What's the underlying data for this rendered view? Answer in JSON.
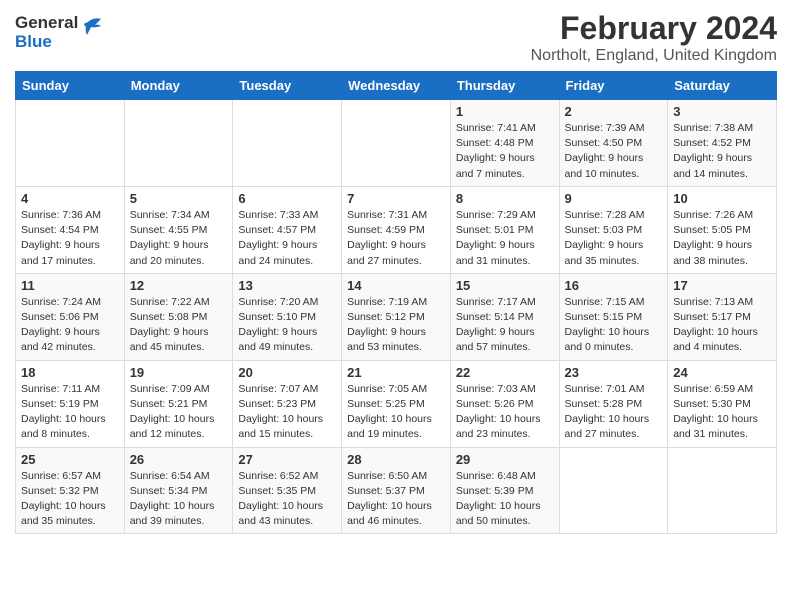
{
  "header": {
    "logo_general": "General",
    "logo_blue": "Blue",
    "title": "February 2024",
    "subtitle": "Northolt, England, United Kingdom"
  },
  "weekdays": [
    "Sunday",
    "Monday",
    "Tuesday",
    "Wednesday",
    "Thursday",
    "Friday",
    "Saturday"
  ],
  "weeks": [
    [
      {
        "day": "",
        "info": ""
      },
      {
        "day": "",
        "info": ""
      },
      {
        "day": "",
        "info": ""
      },
      {
        "day": "",
        "info": ""
      },
      {
        "day": "1",
        "info": "Sunrise: 7:41 AM\nSunset: 4:48 PM\nDaylight: 9 hours\nand 7 minutes."
      },
      {
        "day": "2",
        "info": "Sunrise: 7:39 AM\nSunset: 4:50 PM\nDaylight: 9 hours\nand 10 minutes."
      },
      {
        "day": "3",
        "info": "Sunrise: 7:38 AM\nSunset: 4:52 PM\nDaylight: 9 hours\nand 14 minutes."
      }
    ],
    [
      {
        "day": "4",
        "info": "Sunrise: 7:36 AM\nSunset: 4:54 PM\nDaylight: 9 hours\nand 17 minutes."
      },
      {
        "day": "5",
        "info": "Sunrise: 7:34 AM\nSunset: 4:55 PM\nDaylight: 9 hours\nand 20 minutes."
      },
      {
        "day": "6",
        "info": "Sunrise: 7:33 AM\nSunset: 4:57 PM\nDaylight: 9 hours\nand 24 minutes."
      },
      {
        "day": "7",
        "info": "Sunrise: 7:31 AM\nSunset: 4:59 PM\nDaylight: 9 hours\nand 27 minutes."
      },
      {
        "day": "8",
        "info": "Sunrise: 7:29 AM\nSunset: 5:01 PM\nDaylight: 9 hours\nand 31 minutes."
      },
      {
        "day": "9",
        "info": "Sunrise: 7:28 AM\nSunset: 5:03 PM\nDaylight: 9 hours\nand 35 minutes."
      },
      {
        "day": "10",
        "info": "Sunrise: 7:26 AM\nSunset: 5:05 PM\nDaylight: 9 hours\nand 38 minutes."
      }
    ],
    [
      {
        "day": "11",
        "info": "Sunrise: 7:24 AM\nSunset: 5:06 PM\nDaylight: 9 hours\nand 42 minutes."
      },
      {
        "day": "12",
        "info": "Sunrise: 7:22 AM\nSunset: 5:08 PM\nDaylight: 9 hours\nand 45 minutes."
      },
      {
        "day": "13",
        "info": "Sunrise: 7:20 AM\nSunset: 5:10 PM\nDaylight: 9 hours\nand 49 minutes."
      },
      {
        "day": "14",
        "info": "Sunrise: 7:19 AM\nSunset: 5:12 PM\nDaylight: 9 hours\nand 53 minutes."
      },
      {
        "day": "15",
        "info": "Sunrise: 7:17 AM\nSunset: 5:14 PM\nDaylight: 9 hours\nand 57 minutes."
      },
      {
        "day": "16",
        "info": "Sunrise: 7:15 AM\nSunset: 5:15 PM\nDaylight: 10 hours\nand 0 minutes."
      },
      {
        "day": "17",
        "info": "Sunrise: 7:13 AM\nSunset: 5:17 PM\nDaylight: 10 hours\nand 4 minutes."
      }
    ],
    [
      {
        "day": "18",
        "info": "Sunrise: 7:11 AM\nSunset: 5:19 PM\nDaylight: 10 hours\nand 8 minutes."
      },
      {
        "day": "19",
        "info": "Sunrise: 7:09 AM\nSunset: 5:21 PM\nDaylight: 10 hours\nand 12 minutes."
      },
      {
        "day": "20",
        "info": "Sunrise: 7:07 AM\nSunset: 5:23 PM\nDaylight: 10 hours\nand 15 minutes."
      },
      {
        "day": "21",
        "info": "Sunrise: 7:05 AM\nSunset: 5:25 PM\nDaylight: 10 hours\nand 19 minutes."
      },
      {
        "day": "22",
        "info": "Sunrise: 7:03 AM\nSunset: 5:26 PM\nDaylight: 10 hours\nand 23 minutes."
      },
      {
        "day": "23",
        "info": "Sunrise: 7:01 AM\nSunset: 5:28 PM\nDaylight: 10 hours\nand 27 minutes."
      },
      {
        "day": "24",
        "info": "Sunrise: 6:59 AM\nSunset: 5:30 PM\nDaylight: 10 hours\nand 31 minutes."
      }
    ],
    [
      {
        "day": "25",
        "info": "Sunrise: 6:57 AM\nSunset: 5:32 PM\nDaylight: 10 hours\nand 35 minutes."
      },
      {
        "day": "26",
        "info": "Sunrise: 6:54 AM\nSunset: 5:34 PM\nDaylight: 10 hours\nand 39 minutes."
      },
      {
        "day": "27",
        "info": "Sunrise: 6:52 AM\nSunset: 5:35 PM\nDaylight: 10 hours\nand 43 minutes."
      },
      {
        "day": "28",
        "info": "Sunrise: 6:50 AM\nSunset: 5:37 PM\nDaylight: 10 hours\nand 46 minutes."
      },
      {
        "day": "29",
        "info": "Sunrise: 6:48 AM\nSunset: 5:39 PM\nDaylight: 10 hours\nand 50 minutes."
      },
      {
        "day": "",
        "info": ""
      },
      {
        "day": "",
        "info": ""
      }
    ]
  ]
}
